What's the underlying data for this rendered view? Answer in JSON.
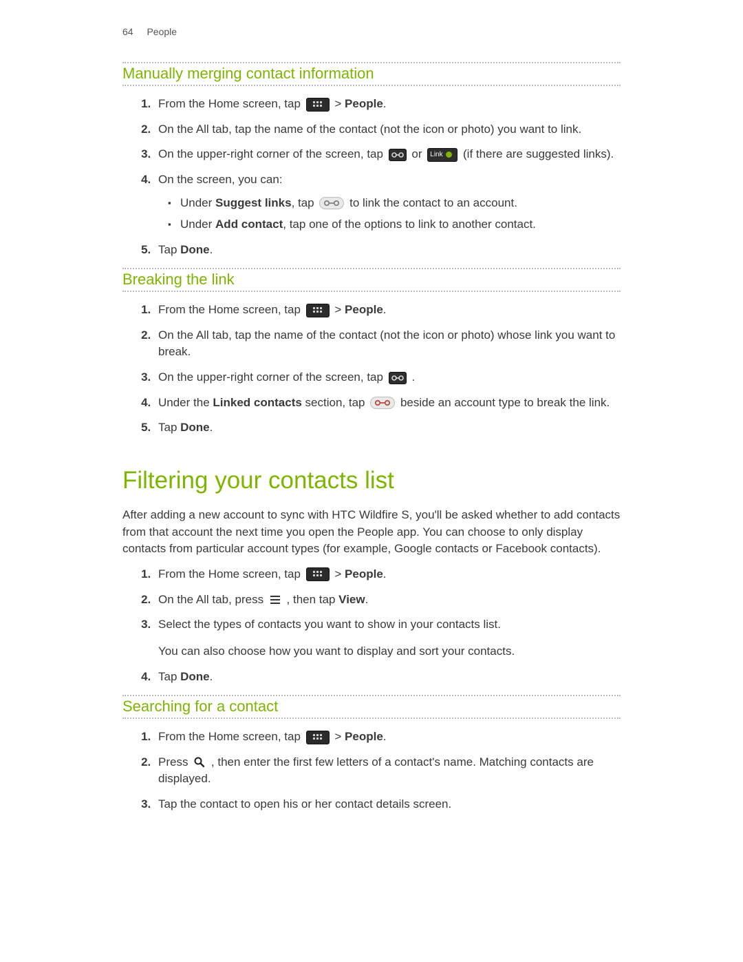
{
  "page": {
    "number": "64",
    "section": "People"
  },
  "headings": {
    "merge": "Manually merging contact information",
    "break": "Breaking the link",
    "filter": "Filtering your contacts list",
    "search": "Searching for a contact"
  },
  "common": {
    "from_home_tap": "From the Home screen, tap ",
    "arrow_people_prefix": "  > ",
    "people_bold": "People",
    "period": "."
  },
  "merge": {
    "s2": "On the All tab, tap the name of the contact (not the icon or photo) you want to link.",
    "s3_a": "On the upper-right corner of the screen, tap ",
    "s3_or": " or ",
    "s3_b": " (if there are suggested links).",
    "s4": "On the screen, you can:",
    "s4_b1_a": "Under ",
    "s4_b1_bold": "Suggest links",
    "s4_b1_b": ", tap ",
    "s4_b1_c": "  to link the contact to an account.",
    "s4_b2_a": "Under ",
    "s4_b2_bold": "Add contact",
    "s4_b2_b": ", tap one of the options to link to another contact.",
    "s5_a": "Tap ",
    "s5_bold": "Done",
    "s5_b": "."
  },
  "break_link": {
    "s2": "On the All tab, tap the name of the contact (not the icon or photo) whose link you want to break.",
    "s3_a": "On the upper-right corner of the screen, tap ",
    "s3_b": " .",
    "s4_a": "Under the ",
    "s4_bold": "Linked contacts",
    "s4_b": " section, tap ",
    "s4_c": "  beside an account type to break the link.",
    "s5_a": "Tap ",
    "s5_bold": "Done",
    "s5_b": "."
  },
  "filter": {
    "intro": "After adding a new account to sync with HTC Wildfire S, you'll be asked whether to add contacts from that account the next time you open the People app. You can choose to only display contacts from particular account types (for example, Google contacts or Facebook contacts).",
    "s2_a": "On the All tab, press ",
    "s2_b": " , then tap ",
    "s2_bold": "View",
    "s2_c": ".",
    "s3": "Select the types of contacts you want to show in your contacts list.",
    "s3_para": "You can also choose how you want to display and sort your contacts.",
    "s4_a": "Tap ",
    "s4_bold": "Done",
    "s4_b": "."
  },
  "search": {
    "s2_a": "Press ",
    "s2_b": " , then enter the first few letters of a contact's name. Matching contacts are displayed.",
    "s3": "Tap the contact to open his or her contact details screen."
  },
  "icons": {
    "apps": "apps-grid-icon",
    "chain": "chain-link-icon",
    "link_badge": "link-suggestion-badge-icon",
    "link_pill": "link-pill-icon",
    "break_pill": "break-link-pill-icon",
    "menu": "menu-icon",
    "search": "search-icon",
    "link_badge_label": "Link"
  }
}
